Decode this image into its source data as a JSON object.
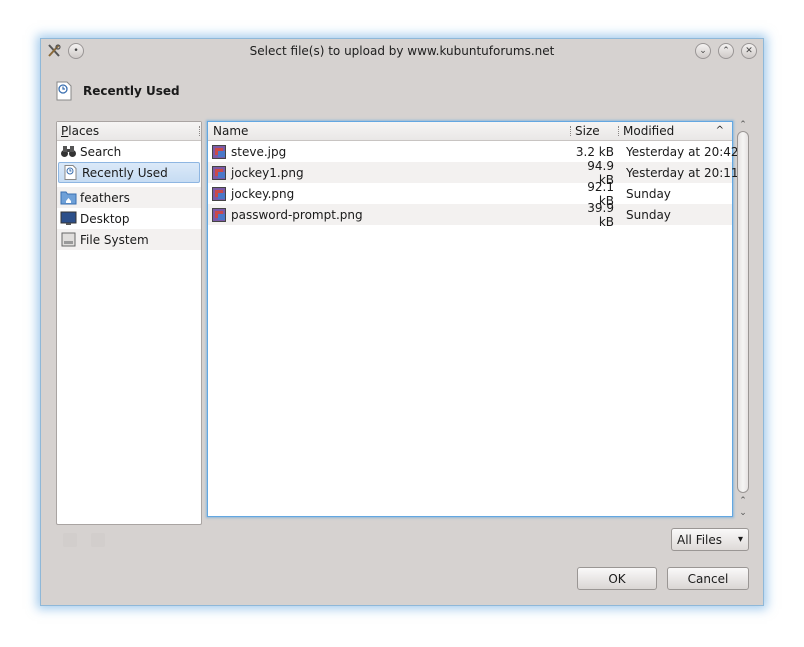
{
  "window": {
    "title": "Select file(s) to upload by www.kubuntuforums.net"
  },
  "header": {
    "title": "Recently Used"
  },
  "places": {
    "header_prefix": "P",
    "header_rest": "laces",
    "items": [
      {
        "label": "Search",
        "icon": "binoculars-icon"
      },
      {
        "label": "Recently Used",
        "icon": "recent-document-icon"
      },
      {
        "label": "feathers",
        "icon": "home-folder-icon"
      },
      {
        "label": "Desktop",
        "icon": "desktop-icon"
      },
      {
        "label": "File System",
        "icon": "drive-icon"
      }
    ]
  },
  "files": {
    "columns": {
      "name": "Name",
      "size": "Size",
      "modified": "Modified"
    },
    "sort_arrow": "^",
    "rows": [
      {
        "name": "steve.jpg",
        "size": "3.2 kB",
        "modified": "Yesterday at 20:42"
      },
      {
        "name": "jockey1.png",
        "size": "94.9 kB",
        "modified": "Yesterday at 20:11"
      },
      {
        "name": "jockey.png",
        "size": "92.1 kB",
        "modified": "Sunday"
      },
      {
        "name": "password-prompt.png",
        "size": "39.9 kB",
        "modified": "Sunday"
      }
    ]
  },
  "filter": {
    "selected": "All Files"
  },
  "buttons": {
    "ok": "OK",
    "cancel": "Cancel"
  }
}
